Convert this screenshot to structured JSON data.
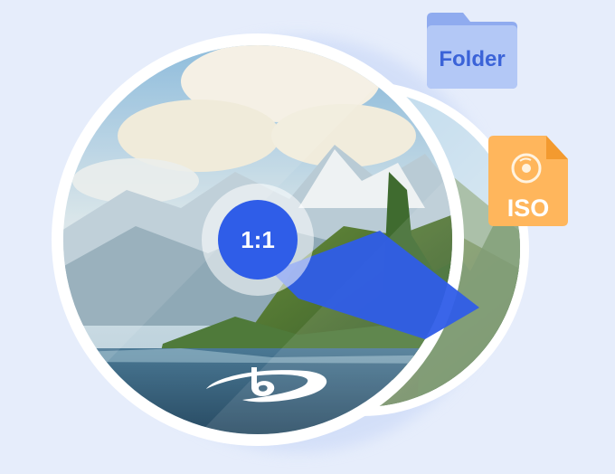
{
  "ratio_badge": {
    "label": "1:1"
  },
  "folder_icon": {
    "label": "Folder",
    "color": "#a9c0f5",
    "text_color": "#3b63d8"
  },
  "iso_icon": {
    "label": "ISO",
    "color": "#ffb65c",
    "text_color": "#ffffff"
  },
  "colors": {
    "background": "#e6edfb",
    "accent_blue": "#2f5de8",
    "disc_rim": "#ffffff"
  },
  "icons": [
    "bluray-logo-icon",
    "disc-icon",
    "folder-icon",
    "iso-file-icon",
    "arrow-right-icon"
  ]
}
